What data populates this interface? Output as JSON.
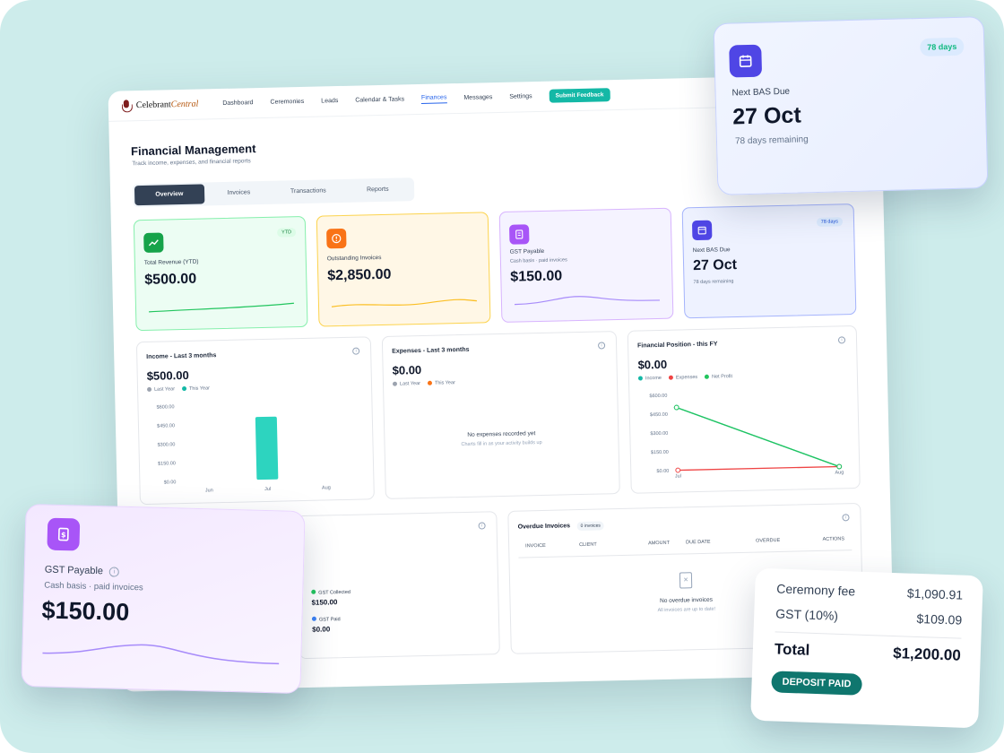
{
  "app": {
    "logo_part1": "Celebrant",
    "logo_part2": "Central",
    "nav": [
      "Dashboard",
      "Ceremonies",
      "Leads",
      "Calendar & Tasks",
      "Finances",
      "Messages",
      "Settings"
    ],
    "nav_active": "Finances",
    "feedback_label": "Submit Feedback",
    "page_title": "Financial Management",
    "page_subtitle": "Track income, expenses, and financial reports",
    "tabs": [
      "Overview",
      "Invoices",
      "Transactions",
      "Reports"
    ],
    "active_tab": "Overview"
  },
  "stats": {
    "revenue": {
      "label": "Total Revenue (YTD)",
      "badge": "YTD",
      "value": "$500.00"
    },
    "outstanding": {
      "label": "Outstanding Invoices",
      "value": "$2,850.00"
    },
    "gst": {
      "label": "GST Payable",
      "sub": "Cash basis · paid invoices",
      "value": "$150.00"
    },
    "bas": {
      "label": "Next BAS Due",
      "badge": "78 days",
      "value": "27 Oct",
      "sub": "78 days remaining"
    }
  },
  "income": {
    "title": "Income - Last 3 months",
    "value": "$500.00",
    "legend": [
      "Last Year",
      "This Year"
    ]
  },
  "expenses": {
    "title": "Expenses - Last 3 months",
    "value": "$0.00",
    "legend": [
      "Last Year",
      "This Year"
    ],
    "empty_title": "No expenses recorded yet",
    "empty_sub": "Charts fill in as your activity builds up"
  },
  "position": {
    "title": "Financial Position - this FY",
    "value": "$0.00",
    "legend": [
      "Income",
      "Expenses",
      "Net Profit"
    ]
  },
  "chart_data": [
    {
      "type": "bar",
      "title": "Income - Last 3 months",
      "categories": [
        "Jun",
        "Jul",
        "Aug"
      ],
      "y_ticks": [
        "$600.00",
        "$450.00",
        "$300.00",
        "$150.00",
        "$0.00"
      ],
      "ylim": [
        0,
        600
      ],
      "series": [
        {
          "name": "Last Year",
          "values": [
            0,
            0,
            0
          ]
        },
        {
          "name": "This Year",
          "values": [
            0,
            500,
            0
          ]
        }
      ]
    },
    {
      "type": "line",
      "title": "Financial Position - this FY",
      "categories": [
        "Jul",
        "Aug"
      ],
      "y_ticks": [
        "$600.00",
        "$450.00",
        "$300.00",
        "$150.00",
        "$0.00"
      ],
      "ylim": [
        0,
        600
      ],
      "series": [
        {
          "name": "Income",
          "values": [
            500,
            0
          ]
        },
        {
          "name": "Expenses",
          "values": [
            0,
            0
          ]
        },
        {
          "name": "Net Profit",
          "values": [
            500,
            0
          ]
        }
      ]
    }
  ],
  "gst_summary": {
    "collected_label": "GST Collected",
    "collected_value": "$150.00",
    "paid_label": "GST Paid",
    "paid_value": "$0.00"
  },
  "overdue": {
    "title": "Overdue Invoices",
    "count": "0 invoices",
    "columns": [
      "INVOICE",
      "CLIENT",
      "AMOUNT",
      "DUE DATE",
      "OVERDUE",
      "ACTIONS"
    ],
    "empty_title": "No overdue invoices",
    "empty_sub": "All invoices are up to date!"
  },
  "float_bas": {
    "badge": "78 days",
    "label": "Next BAS Due",
    "value": "27 Oct",
    "sub": "78 days remaining"
  },
  "float_gst": {
    "label": "GST Payable",
    "sub": "Cash basis · paid invoices",
    "value": "$150.00"
  },
  "receipt": {
    "rows": [
      {
        "label": "Ceremony fee",
        "value": "$1,090.91"
      },
      {
        "label": "GST (10%)",
        "value": "$109.09"
      }
    ],
    "total_label": "Total",
    "total_value": "$1,200.00",
    "badge": "DEPOSIT PAID"
  },
  "colors": {
    "teal": "#14b8a6",
    "green": "#22c55e",
    "orange": "#f97316",
    "purple": "#a855f7",
    "blue": "#4f46e5",
    "red": "#ef4444"
  }
}
